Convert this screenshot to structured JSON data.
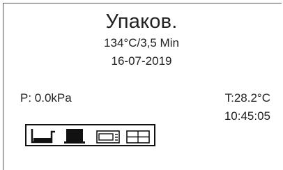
{
  "screen": {
    "title": "Упаков.",
    "program": "134°C/3,5 Min",
    "date": "16-07-2019"
  },
  "readouts": {
    "pressure": "P:  0.0kPa",
    "temperature": "T:28.2°C",
    "time": "10:45:05"
  },
  "status_icons": [
    "tray-empty-icon",
    "tray-full-icon",
    "printer-icon",
    "grid-icon"
  ],
  "colors": {
    "background": "#ffffff",
    "text": "#222222",
    "icon": "#111111"
  }
}
